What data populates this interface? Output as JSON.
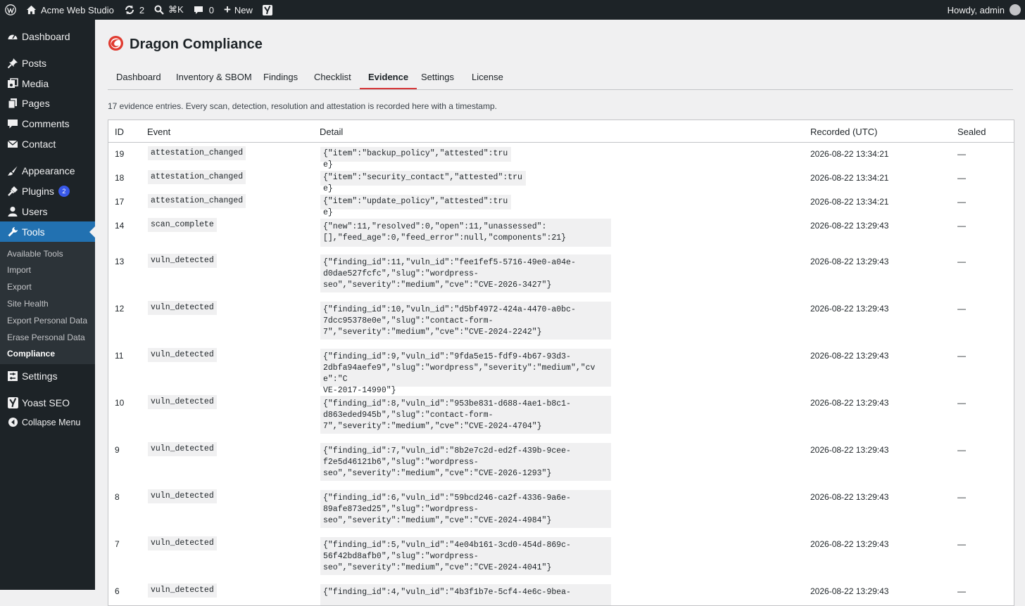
{
  "adminbar": {
    "site_name": "Acme Web Studio",
    "updates_count": "2",
    "search_shortcut": "⌘K",
    "comments_count": "0",
    "new_label": "New",
    "howdy": "Howdy, admin"
  },
  "sidebar": {
    "dashboard": "Dashboard",
    "posts": "Posts",
    "media": "Media",
    "pages": "Pages",
    "comments": "Comments",
    "contact": "Contact",
    "appearance": "Appearance",
    "plugins": "Plugins",
    "plugins_badge": "2",
    "users": "Users",
    "tools": "Tools",
    "settings": "Settings",
    "yoast": "Yoast SEO",
    "collapse": "Collapse Menu",
    "submenu": [
      "Available Tools",
      "Import",
      "Export",
      "Site Health",
      "Export Personal Data",
      "Erase Personal Data",
      "Compliance"
    ]
  },
  "page": {
    "title": "Dragon Compliance",
    "tabs": [
      "Dashboard",
      "Inventory & SBOM",
      "Findings",
      "Checklist",
      "Evidence",
      "Settings",
      "License"
    ],
    "active_tab": "Evidence",
    "intro": "17 evidence entries. Every scan, detection, resolution and attestation is recorded here with a timestamp."
  },
  "table": {
    "headers": {
      "id": "ID",
      "event": "Event",
      "detail": "Detail",
      "recorded": "Recorded (UTC)",
      "sealed": "Sealed"
    },
    "rows": [
      {
        "id": "19",
        "event": "attestation_changed",
        "detail": "{\"item\":\"backup_policy\",\"attested\":true}",
        "recorded": "2026-08-22 13:34:21",
        "sealed": "—"
      },
      {
        "id": "18",
        "event": "attestation_changed",
        "detail": "{\"item\":\"security_contact\",\"attested\":true}",
        "recorded": "2026-08-22 13:34:21",
        "sealed": "—"
      },
      {
        "id": "17",
        "event": "attestation_changed",
        "detail": "{\"item\":\"update_policy\",\"attested\":true}",
        "recorded": "2026-08-22 13:34:21",
        "sealed": "—"
      },
      {
        "id": "14",
        "event": "scan_complete",
        "detail": "{\"new\":11,\"resolved\":0,\"open\":11,\"unassessed\":\n[],\"feed_age\":0,\"feed_error\":null,\"components\":21}",
        "recorded": "2026-08-22 13:29:43",
        "sealed": "—"
      },
      {
        "id": "13",
        "event": "vuln_detected",
        "detail": "{\"finding_id\":11,\"vuln_id\":\"fee1fef5-5716-49e0-a04e-\nd0dae527fcfc\",\"slug\":\"wordpress-\nseo\",\"severity\":\"medium\",\"cve\":\"CVE-2026-3427\"}",
        "recorded": "2026-08-22 13:29:43",
        "sealed": "—"
      },
      {
        "id": "12",
        "event": "vuln_detected",
        "detail": "{\"finding_id\":10,\"vuln_id\":\"d5bf4972-424a-4470-a0bc-\n7dcc95378e0e\",\"slug\":\"contact-form-\n7\",\"severity\":\"medium\",\"cve\":\"CVE-2024-2242\"}",
        "recorded": "2026-08-22 13:29:43",
        "sealed": "—"
      },
      {
        "id": "11",
        "event": "vuln_detected",
        "detail": "{\"finding_id\":9,\"vuln_id\":\"9fda5e15-fdf9-4b67-93d3-\n2dbfa94aefe9\",\"slug\":\"wordpress\",\"severity\":\"medium\",\"cve\":\"C\nVE-2017-14990\"}",
        "recorded": "2026-08-22 13:29:43",
        "sealed": "—"
      },
      {
        "id": "10",
        "event": "vuln_detected",
        "detail": "{\"finding_id\":8,\"vuln_id\":\"953be831-d688-4ae1-b8c1-\nd863eded945b\",\"slug\":\"contact-form-\n7\",\"severity\":\"medium\",\"cve\":\"CVE-2024-4704\"}",
        "recorded": "2026-08-22 13:29:43",
        "sealed": "—"
      },
      {
        "id": "9",
        "event": "vuln_detected",
        "detail": "{\"finding_id\":7,\"vuln_id\":\"8b2e7c2d-ed2f-439b-9cee-\nf2e5d46121b6\",\"slug\":\"wordpress-\nseo\",\"severity\":\"medium\",\"cve\":\"CVE-2026-1293\"}",
        "recorded": "2026-08-22 13:29:43",
        "sealed": "—"
      },
      {
        "id": "8",
        "event": "vuln_detected",
        "detail": "{\"finding_id\":6,\"vuln_id\":\"59bcd246-ca2f-4336-9a6e-\n89afe873ed25\",\"slug\":\"wordpress-\nseo\",\"severity\":\"medium\",\"cve\":\"CVE-2024-4984\"}",
        "recorded": "2026-08-22 13:29:43",
        "sealed": "—"
      },
      {
        "id": "7",
        "event": "vuln_detected",
        "detail": "{\"finding_id\":5,\"vuln_id\":\"4e04b161-3cd0-454d-869c-\n56f42bd8afb0\",\"slug\":\"wordpress-\nseo\",\"severity\":\"medium\",\"cve\":\"CVE-2024-4041\"}",
        "recorded": "2026-08-22 13:29:43",
        "sealed": "—"
      },
      {
        "id": "6",
        "event": "vuln_detected",
        "detail": "{\"finding_id\":4,\"vuln_id\":\"4b3f1b7e-5cf4-4e6c-9bea-",
        "recorded": "2026-08-22 13:29:43",
        "sealed": "—"
      }
    ]
  }
}
